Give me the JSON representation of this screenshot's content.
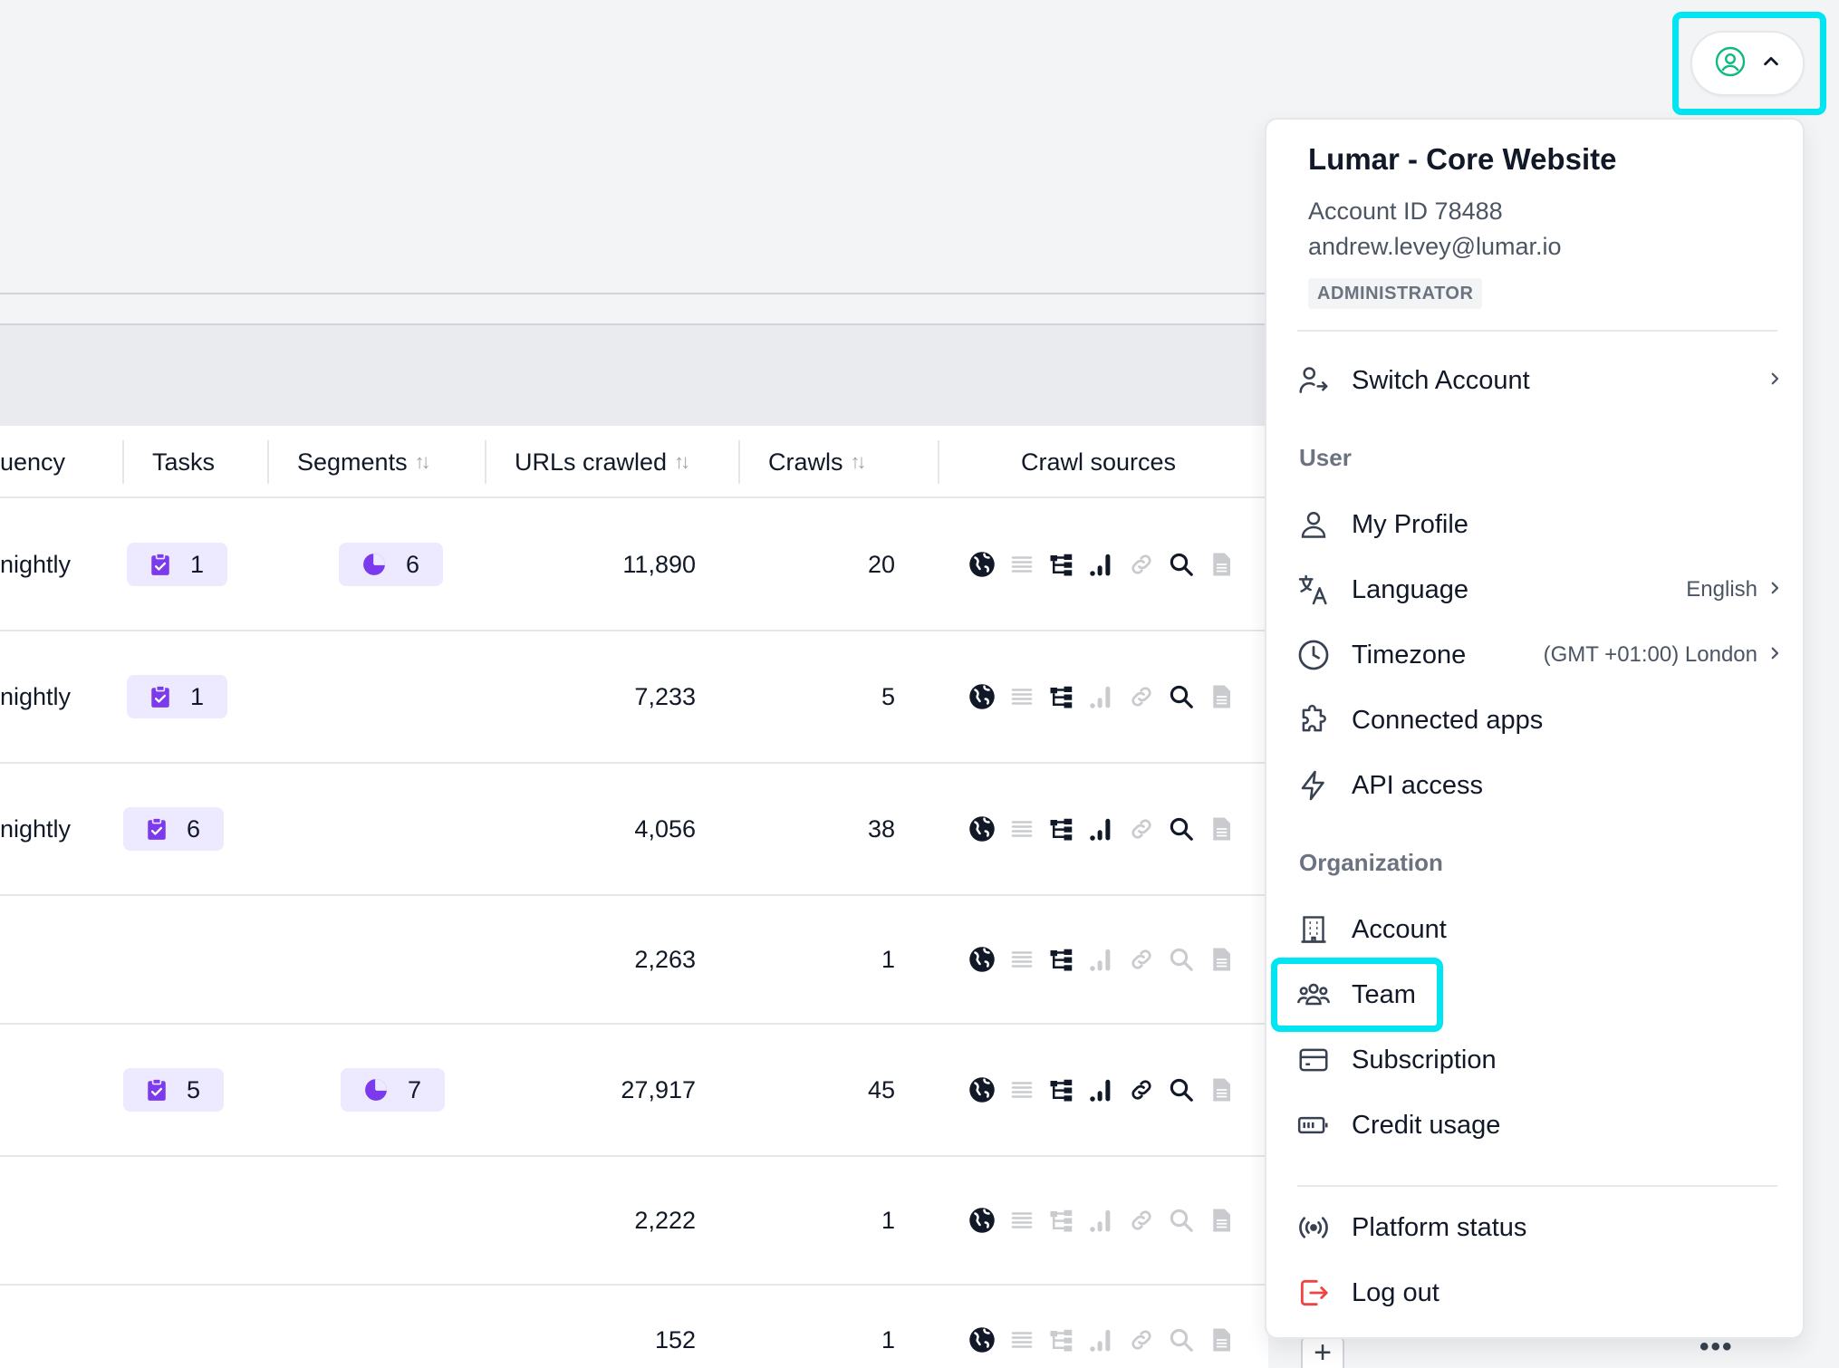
{
  "table": {
    "headers": {
      "frequency": "uency",
      "tasks": "Tasks",
      "segments": "Segments",
      "urls_crawled": "URLs crawled",
      "crawls": "Crawls",
      "crawl_sources": "Crawl sources",
      "sort_icon": "↑↓"
    },
    "rows": [
      {
        "frequency": "nightly",
        "tasks": "1",
        "segments": "6",
        "urls": "11,890",
        "crawls": "20",
        "sources": [
          true,
          false,
          true,
          true,
          false,
          true,
          false
        ]
      },
      {
        "frequency": "nightly",
        "tasks": "1",
        "segments": "",
        "urls": "7,233",
        "crawls": "5",
        "sources": [
          true,
          false,
          true,
          false,
          false,
          true,
          false
        ]
      },
      {
        "frequency": "nightly",
        "tasks": "6",
        "segments": "",
        "urls": "4,056",
        "crawls": "38",
        "sources": [
          true,
          false,
          true,
          true,
          false,
          true,
          false
        ]
      },
      {
        "frequency": "",
        "tasks": "",
        "segments": "",
        "urls": "2,263",
        "crawls": "1",
        "sources": [
          true,
          false,
          true,
          false,
          false,
          false,
          false
        ]
      },
      {
        "frequency": "",
        "tasks": "5",
        "segments": "7",
        "urls": "27,917",
        "crawls": "45",
        "sources": [
          true,
          false,
          true,
          true,
          true,
          true,
          false
        ]
      },
      {
        "frequency": "",
        "tasks": "",
        "segments": "",
        "urls": "2,222",
        "crawls": "1",
        "sources": [
          true,
          false,
          false,
          false,
          false,
          false,
          false
        ]
      },
      {
        "frequency": "",
        "tasks": "",
        "segments": "",
        "urls": "152",
        "crawls": "1",
        "sources": [
          true,
          false,
          false,
          false,
          false,
          false,
          false
        ]
      }
    ],
    "source_icons": [
      "globe-icon",
      "list-icon",
      "sitemap-icon",
      "analytics-icon",
      "backlinks-icon",
      "search-console-icon",
      "log-file-icon"
    ]
  },
  "account_menu": {
    "account_name": "Lumar - Core Website",
    "account_id": "Account ID 78488",
    "email": "andrew.levey@lumar.io",
    "role": "ADMINISTRATOR",
    "switch_account": "Switch Account",
    "user_section": "User",
    "my_profile": "My Profile",
    "language": "Language",
    "language_value": "English",
    "timezone": "Timezone",
    "timezone_value": "(GMT +01:00) London",
    "connected_apps": "Connected apps",
    "api_access": "API access",
    "org_section": "Organization",
    "account": "Account",
    "team": "Team",
    "subscription": "Subscription",
    "credit_usage": "Credit usage",
    "platform_status": "Platform status",
    "log_out": "Log out"
  },
  "colors": {
    "accent_purple": "#7c3aed",
    "pill_bg": "#ede9fe",
    "highlight": "#00e5f2",
    "avatar_green": "#10b981",
    "logout_red": "#ef4444"
  },
  "misc": {
    "add": "+",
    "more": "•••"
  }
}
